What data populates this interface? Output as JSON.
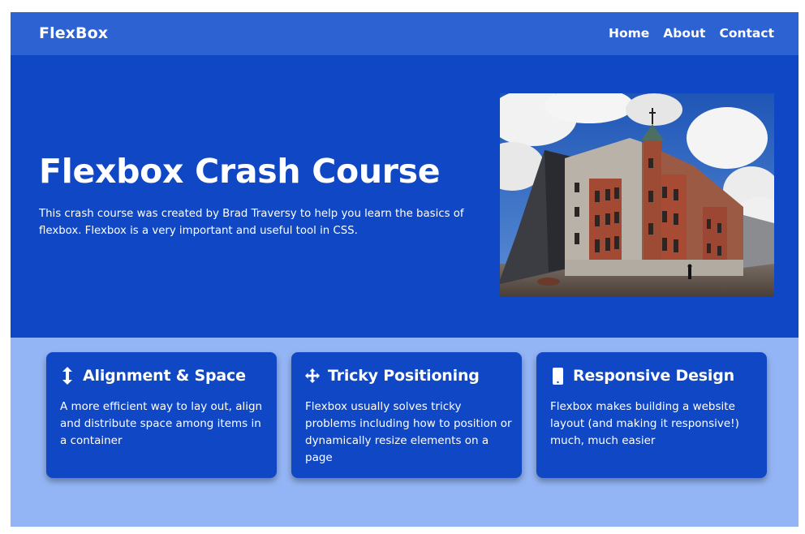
{
  "navbar": {
    "logo": "FlexBox",
    "links": [
      "Home",
      "About",
      "Contact"
    ]
  },
  "hero": {
    "title": "Flexbox Crash Course",
    "text": "This crash course was created by Brad Traversy to help you learn the basics of flexbox. Flexbox is a very important and useful tool in CSS."
  },
  "features": [
    {
      "icon": "arrows-vertical-icon",
      "title": "Alignment & Space",
      "text": "A more efficient way to lay out, align and distribute space among items in a container"
    },
    {
      "icon": "move-arrows-icon",
      "title": "Tricky Positioning",
      "text": "Flexbox usually solves tricky problems including how to position or dynamically resize elements on a page"
    },
    {
      "icon": "mobile-phone-icon",
      "title": "Responsive Design",
      "text": "Flexbox makes building a website layout (and making it responsive!) much, much easier"
    }
  ],
  "colors": {
    "navbar": "#2d62d2",
    "hero": "#0f47c4",
    "features": "#94b5f5",
    "card": "#0f47c4"
  }
}
